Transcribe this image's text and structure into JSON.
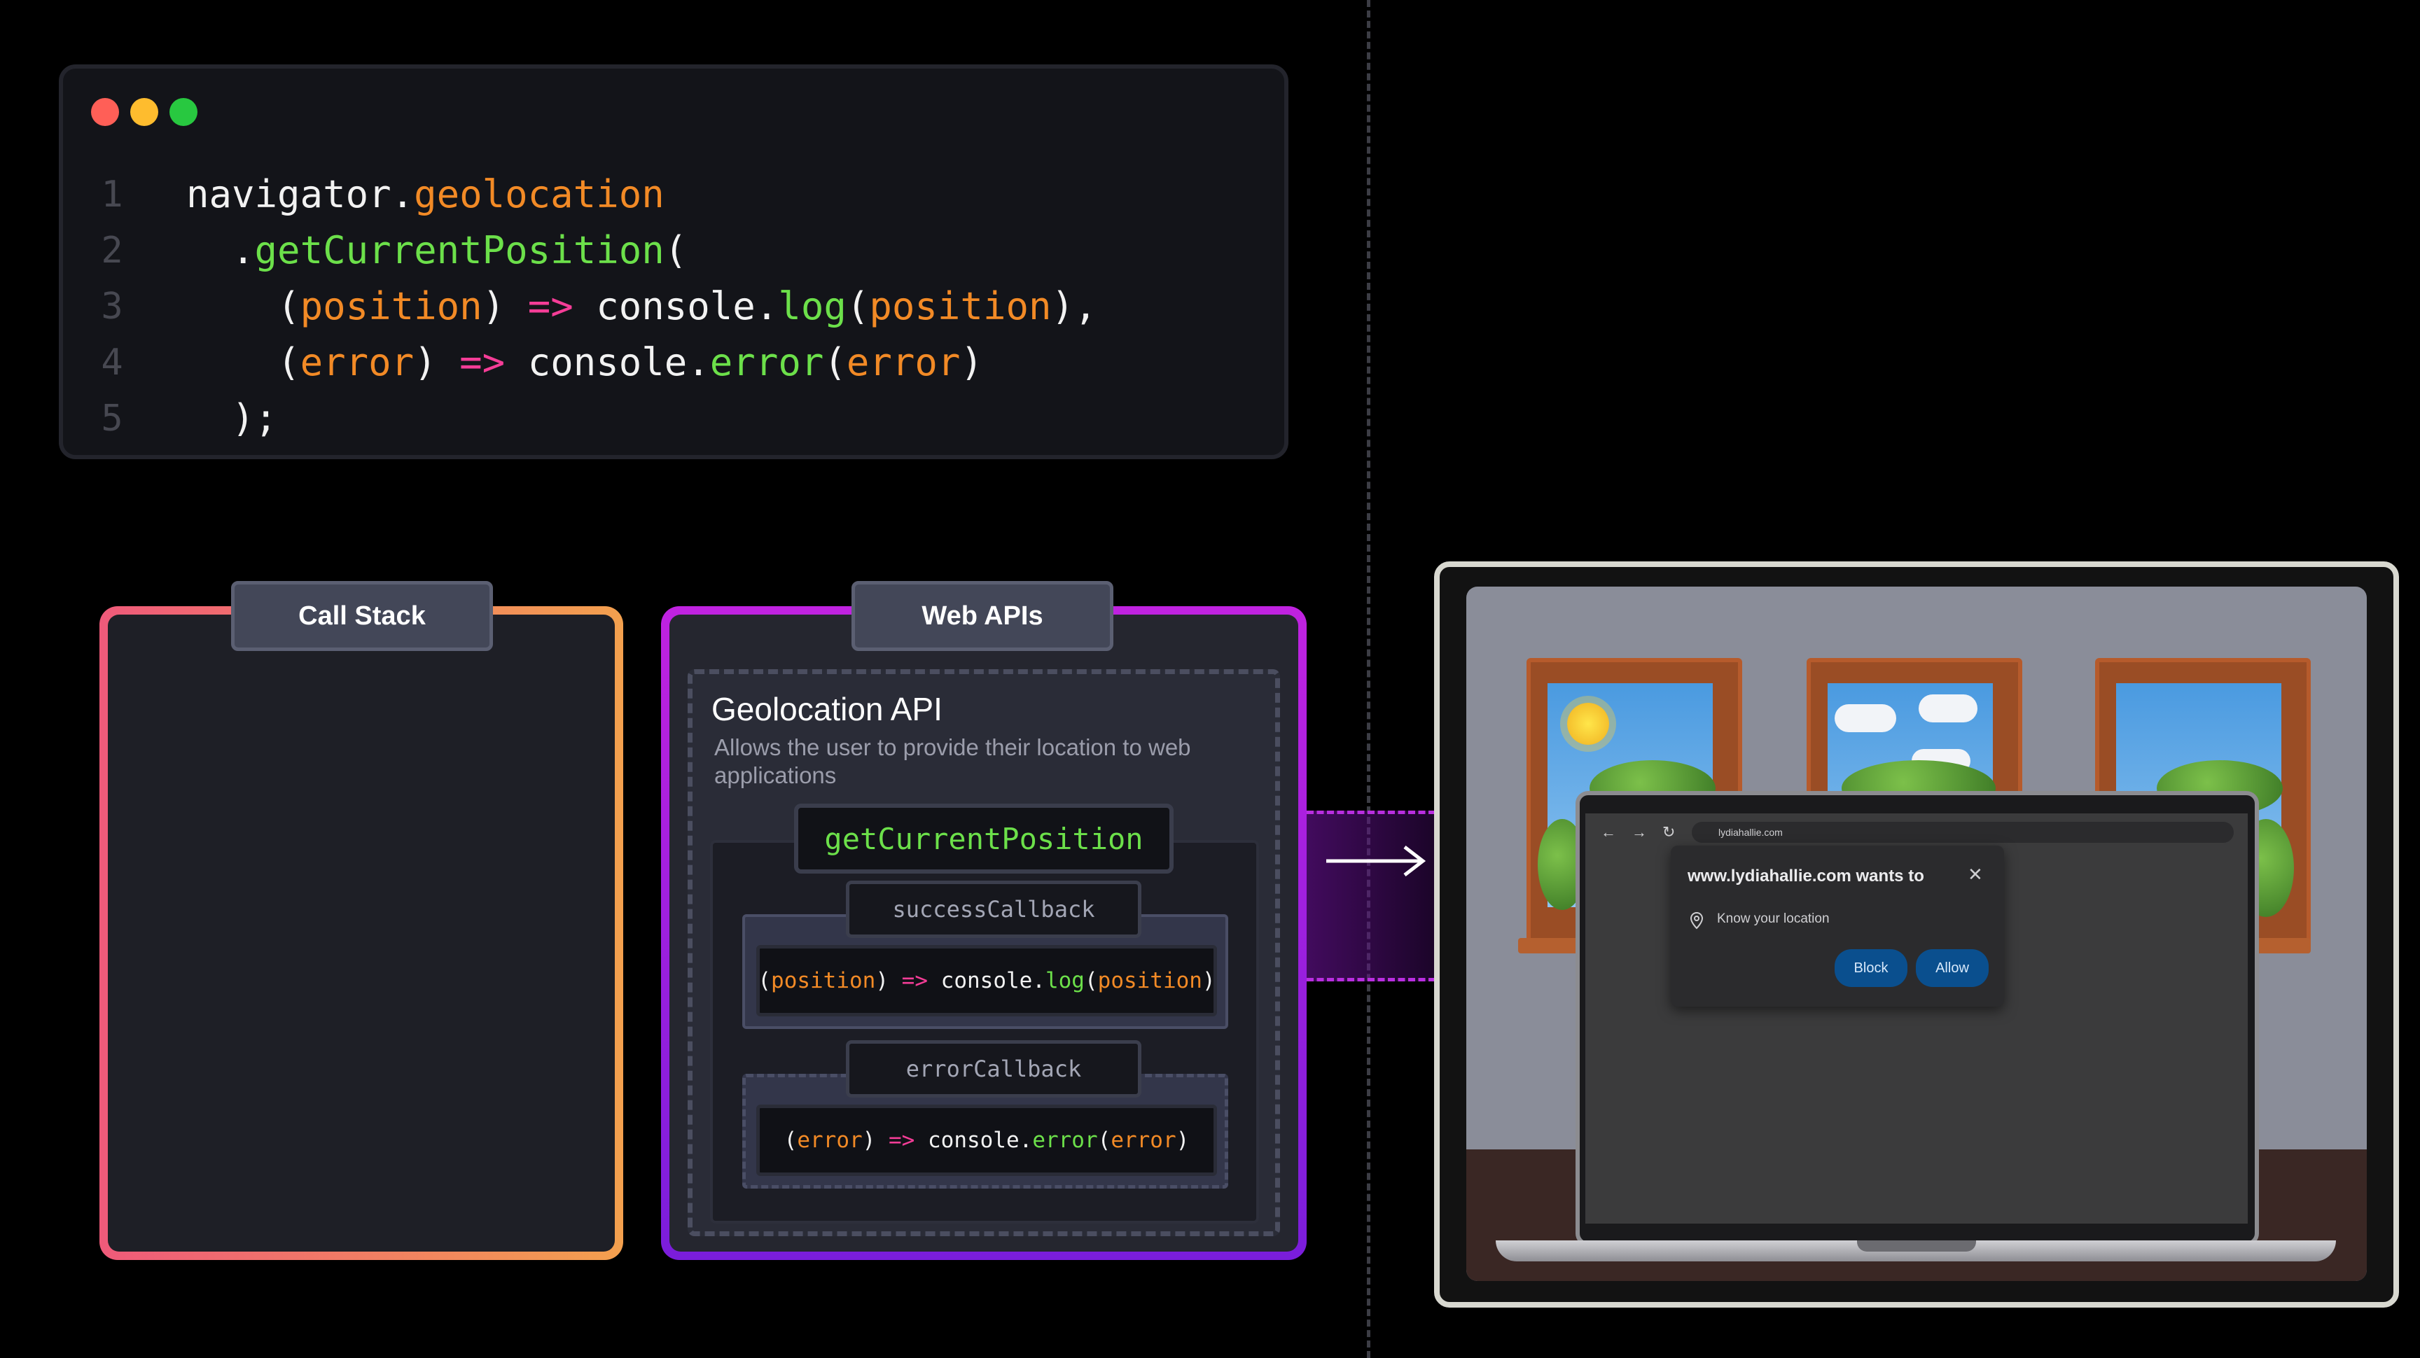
{
  "code": {
    "lines": [
      {
        "number": "1",
        "parts": [
          {
            "t": "navigator.",
            "c": "w"
          },
          {
            "t": "geolocation",
            "c": "o"
          }
        ]
      },
      {
        "number": "2",
        "parts": [
          {
            "t": "  .",
            "c": "w"
          },
          {
            "t": "getCurrentPosition",
            "c": "g"
          },
          {
            "t": "(",
            "c": "w"
          }
        ]
      },
      {
        "number": "3",
        "parts": [
          {
            "t": "    (",
            "c": "w"
          },
          {
            "t": "position",
            "c": "o"
          },
          {
            "t": ") ",
            "c": "w"
          },
          {
            "t": "=>",
            "c": "p"
          },
          {
            "t": " console.",
            "c": "w"
          },
          {
            "t": "log",
            "c": "g"
          },
          {
            "t": "(",
            "c": "w"
          },
          {
            "t": "position",
            "c": "o"
          },
          {
            "t": "),",
            "c": "w"
          }
        ]
      },
      {
        "number": "4",
        "parts": [
          {
            "t": "    (",
            "c": "w"
          },
          {
            "t": "error",
            "c": "o"
          },
          {
            "t": ") ",
            "c": "w"
          },
          {
            "t": "=>",
            "c": "p"
          },
          {
            "t": " console.",
            "c": "w"
          },
          {
            "t": "error",
            "c": "g"
          },
          {
            "t": "(",
            "c": "w"
          },
          {
            "t": "error",
            "c": "o"
          },
          {
            "t": ")",
            "c": "w"
          }
        ]
      },
      {
        "number": "5",
        "parts": [
          {
            "t": "  );",
            "c": "w"
          }
        ]
      }
    ]
  },
  "callstack": {
    "label": "Call Stack"
  },
  "webapis": {
    "label": "Web APIs",
    "geo_title": "Geolocation API",
    "geo_desc": "Allows the user to provide their location to web applications",
    "method": "getCurrentPosition",
    "success_label": "successCallback",
    "error_label": "errorCallback",
    "success_code": [
      {
        "t": "(",
        "c": "w"
      },
      {
        "t": "position",
        "c": "o"
      },
      {
        "t": ") ",
        "c": "w"
      },
      {
        "t": "=>",
        "c": "p"
      },
      {
        "t": " console.",
        "c": "w"
      },
      {
        "t": "log",
        "c": "g"
      },
      {
        "t": "(",
        "c": "w"
      },
      {
        "t": "position",
        "c": "o"
      },
      {
        "t": ")",
        "c": "w"
      }
    ],
    "error_code": [
      {
        "t": "(",
        "c": "w"
      },
      {
        "t": "error",
        "c": "o"
      },
      {
        "t": ") ",
        "c": "w"
      },
      {
        "t": "=>",
        "c": "p"
      },
      {
        "t": " console.",
        "c": "w"
      },
      {
        "t": "error",
        "c": "g"
      },
      {
        "t": "(",
        "c": "w"
      },
      {
        "t": "error",
        "c": "o"
      },
      {
        "t": ")",
        "c": "w"
      }
    ]
  },
  "browser": {
    "url": "lydiahallie.com",
    "prompt_title": "www.lydiahallie.com wants to",
    "prompt_desc": "Know your location",
    "block_label": "Block",
    "allow_label": "Allow",
    "close_glyph": "✕",
    "back_glyph": "←",
    "forward_glyph": "→",
    "reload_glyph": "↻"
  },
  "colors": {
    "orange": "#f28a26",
    "green": "#6ce04a",
    "pink": "#f53d97",
    "callstack_border": [
      "#ef5a7a",
      "#f3a04e"
    ],
    "webapis_border": [
      "#c022e0",
      "#7a1ddb"
    ]
  },
  "icons": [
    "traffic-light-red",
    "traffic-light-yellow",
    "traffic-light-green",
    "arrow-right-icon",
    "location-pin-icon",
    "close-icon"
  ]
}
